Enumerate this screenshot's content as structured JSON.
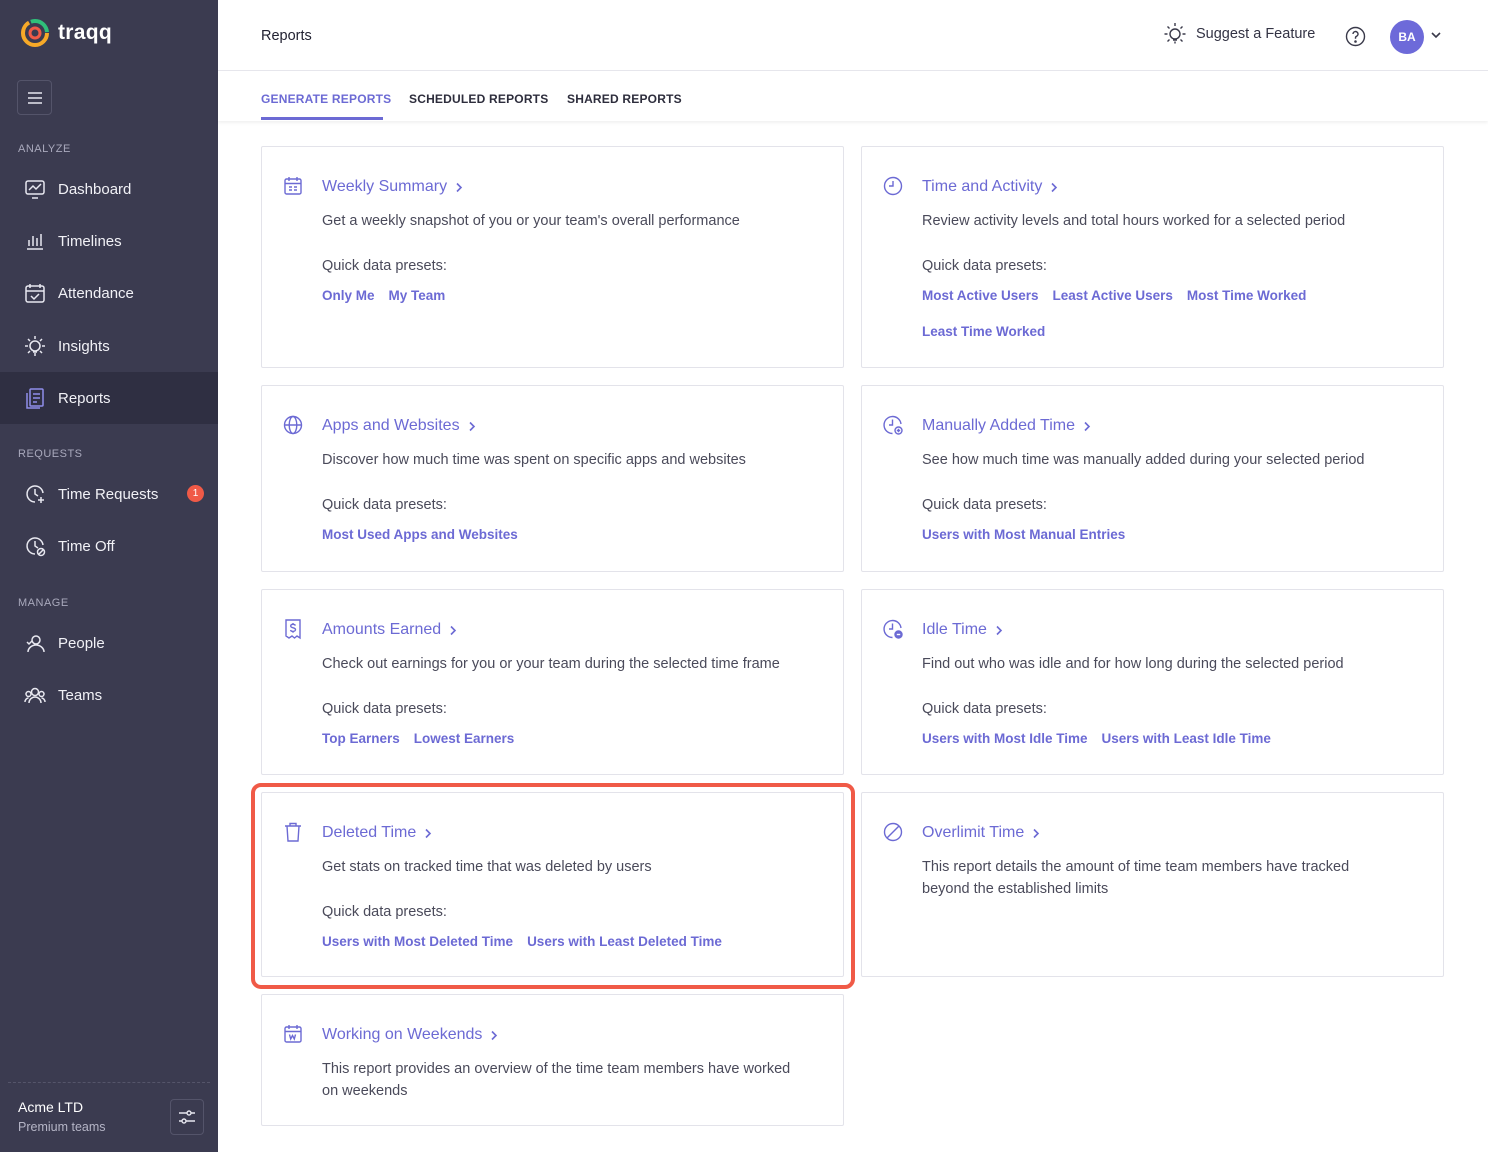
{
  "brand": {
    "name": "traqq"
  },
  "sidebar": {
    "sections": {
      "analyze": "ANALYZE",
      "requests": "REQUESTS",
      "manage": "MANAGE"
    },
    "items": [
      {
        "label": "Dashboard"
      },
      {
        "label": "Timelines"
      },
      {
        "label": "Attendance"
      },
      {
        "label": "Insights"
      },
      {
        "label": "Reports"
      },
      {
        "label": "Time Requests",
        "badge": "1"
      },
      {
        "label": "Time Off"
      },
      {
        "label": "People"
      },
      {
        "label": "Teams"
      }
    ],
    "org": {
      "name": "Acme LTD",
      "plan": "Premium teams"
    }
  },
  "header": {
    "title": "Reports",
    "suggest": "Suggest a Feature",
    "avatar": "BA"
  },
  "tabs": [
    {
      "label": "GENERATE REPORTS",
      "active": true
    },
    {
      "label": "SCHEDULED REPORTS"
    },
    {
      "label": "SHARED REPORTS"
    }
  ],
  "presets_label": "Quick data presets:",
  "cards": [
    {
      "title": "Weekly Summary",
      "icon": "calendar-icon",
      "desc": "Get a weekly snapshot of you or your team's overall performance",
      "presets": [
        "Only Me",
        "My Team"
      ]
    },
    {
      "title": "Time and Activity",
      "icon": "clock-icon",
      "desc": "Review activity levels and total hours worked for a selected period",
      "presets": [
        "Most Active Users",
        "Least Active Users",
        "Most Time Worked",
        "Least Time Worked"
      ]
    },
    {
      "title": "Apps and Websites",
      "icon": "globe-icon",
      "desc": "Discover how much time was spent on specific apps and websites",
      "presets": [
        "Most Used Apps and Websites"
      ]
    },
    {
      "title": "Manually Added Time",
      "icon": "clock-plus-icon",
      "desc": "See how much time was manually added during your selected period",
      "presets": [
        "Users with Most Manual Entries"
      ]
    },
    {
      "title": "Amounts Earned",
      "icon": "dollar-receipt-icon",
      "desc": "Check out earnings for you or your team during the selected time frame",
      "presets": [
        "Top Earners",
        "Lowest Earners"
      ]
    },
    {
      "title": "Idle Time",
      "icon": "clock-minus-icon",
      "desc": "Find out who was idle and for how long during the selected period",
      "presets": [
        "Users with Most Idle Time",
        "Users with Least Idle Time"
      ]
    },
    {
      "title": "Deleted Time",
      "icon": "trash-icon",
      "desc": "Get stats on tracked time that was deleted by users",
      "presets": [
        "Users with Most Deleted Time",
        "Users with Least Deleted Time"
      ]
    },
    {
      "title": "Overlimit Time",
      "icon": "prohibited-icon",
      "desc": "This report details the amount of time team members have tracked beyond the established limits",
      "presets": []
    },
    {
      "title": "Working on Weekends",
      "icon": "calendar-weekend-icon",
      "desc": "This report provides an overview of the time team members have worked on weekends",
      "presets": []
    }
  ],
  "colors": {
    "sidebar": "#3b3b50",
    "accent": "#6c6ad4",
    "highlight": "#f05a47"
  }
}
